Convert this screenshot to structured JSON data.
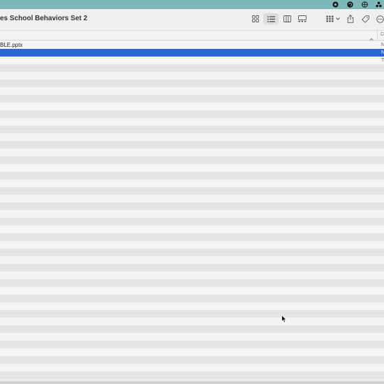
{
  "menubar": {
    "icons": [
      "record-icon",
      "chat-icon",
      "globe-icon",
      "apps-icon"
    ]
  },
  "toolbar": {
    "title": "es School Behaviors Set 2",
    "view_icons": [
      "icon-view",
      "list-view",
      "column-view",
      "gallery-view"
    ],
    "active_view": "list-view",
    "action_icons": [
      "group-icon",
      "share-icon",
      "tag-icon",
      "more-icon"
    ]
  },
  "columns": {
    "sort_indicator": "^",
    "date_label": "D"
  },
  "files": [
    {
      "name": "BLE.pptx",
      "kind": "N"
    },
    {
      "name": "",
      "kind": "N",
      "selected": true
    },
    {
      "name": "",
      "kind": "T"
    }
  ],
  "empty_rows": 41,
  "colors": {
    "menubar": "#7fb8b8",
    "selection": "#2b66d6"
  }
}
